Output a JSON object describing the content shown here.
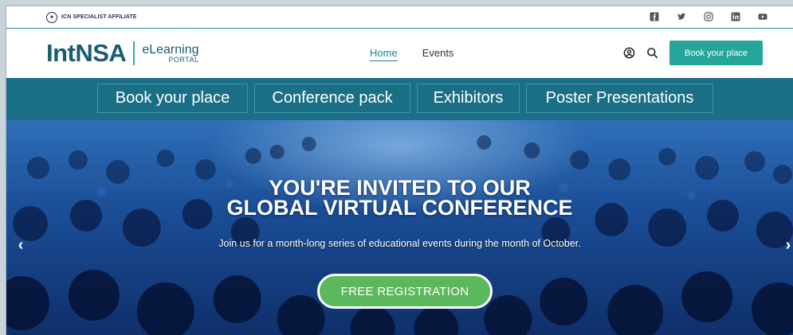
{
  "topbar": {
    "affiliate_text": "ICN SPECIALIST AFFILIATE",
    "socials": [
      "facebook-icon",
      "twitter-icon",
      "instagram-icon",
      "linkedin-icon",
      "youtube-icon"
    ]
  },
  "header": {
    "logo_main": "IntNSA",
    "logo_sub1": "eLearning",
    "logo_sub2": "PORTAL",
    "nav": [
      {
        "label": "Home",
        "active": true
      },
      {
        "label": "Events",
        "active": false
      }
    ],
    "book_button": "Book your place"
  },
  "menu": [
    {
      "label": "Book your place"
    },
    {
      "label": "Conference pack"
    },
    {
      "label": "Exhibitors"
    },
    {
      "label": "Poster Presentations"
    }
  ],
  "hero": {
    "title_line1": "YOU'RE INVITED TO OUR",
    "title_line2": "GLOBAL VIRTUAL CONFERENCE",
    "subtitle": "Join us for a month-long series of educational events during the month of October.",
    "cta": "FREE REGISTRATION",
    "prev": "‹",
    "next": "›"
  },
  "colors": {
    "brand": "#1b5b73",
    "accent": "#26a69a",
    "menu_bg": "#1a6f86",
    "cta": "#5cb85c"
  }
}
